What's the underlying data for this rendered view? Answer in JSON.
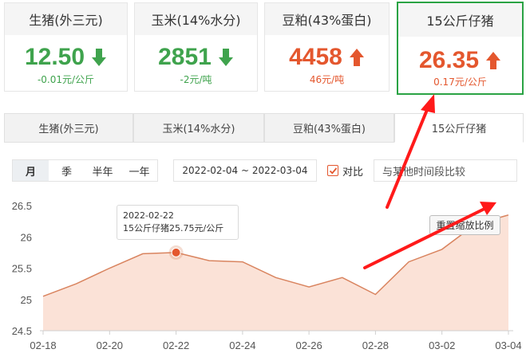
{
  "cards": [
    {
      "name": "生猪(外三元)",
      "price": "12.50",
      "change": "-0.01元/公斤",
      "direction": "down"
    },
    {
      "name": "玉米(14%水分)",
      "price": "2851",
      "change": "-2元/吨",
      "direction": "down"
    },
    {
      "name": "豆粕(43%蛋白)",
      "price": "4458",
      "change": "46元/吨",
      "direction": "up"
    },
    {
      "name": "15公斤仔猪",
      "price": "26.35",
      "change": "0.17元/公斤",
      "direction": "up"
    }
  ],
  "tabs": [
    {
      "label": "生猪(外三元)"
    },
    {
      "label": "玉米(14%水分)"
    },
    {
      "label": "豆粕(43%蛋白)"
    },
    {
      "label": "15公斤仔猪",
      "active": true
    }
  ],
  "range_buttons": [
    {
      "label": "月",
      "active": true
    },
    {
      "label": "季"
    },
    {
      "label": "半年"
    },
    {
      "label": "一年"
    }
  ],
  "date_range": "2022-02-04 ~ 2022-03-04",
  "compare": {
    "label": "对比",
    "checked": true,
    "placeholder": "与某他时间段比较"
  },
  "tooltip": {
    "date": "2022-02-22",
    "text": "15公斤仔猪25.75元/公斤"
  },
  "reset_button": "重置缩放比例",
  "colors": {
    "up": "#e4572e",
    "down": "#3fa34d",
    "selected_border": "#2aa344",
    "line": "#d9845f",
    "area": "#fbe2d7"
  },
  "chart_data": {
    "type": "area",
    "series": [
      {
        "values": [
          25.05,
          25.25,
          25.5,
          25.73,
          25.75,
          25.62,
          25.6,
          25.35,
          25.2,
          25.35,
          25.08,
          25.6,
          25.8,
          26.2,
          26.35
        ]
      }
    ],
    "x": [
      "02-18",
      "02-19",
      "02-20",
      "02-21",
      "02-22",
      "02-23",
      "02-24",
      "02-25",
      "02-26",
      "02-27",
      "02-28",
      "03-01",
      "03-02",
      "03-03",
      "03-04"
    ],
    "x_tick_labels": [
      "02-18",
      "02-20",
      "02-22",
      "02-24",
      "02-26",
      "02-28",
      "03-02",
      "03-04"
    ],
    "y_tick_labels": [
      "24.5",
      "25",
      "25.5",
      "26",
      "26.5"
    ],
    "ylim": [
      24.5,
      26.5
    ],
    "highlight": {
      "x": "02-22",
      "y": 25.75
    },
    "grid": false
  }
}
